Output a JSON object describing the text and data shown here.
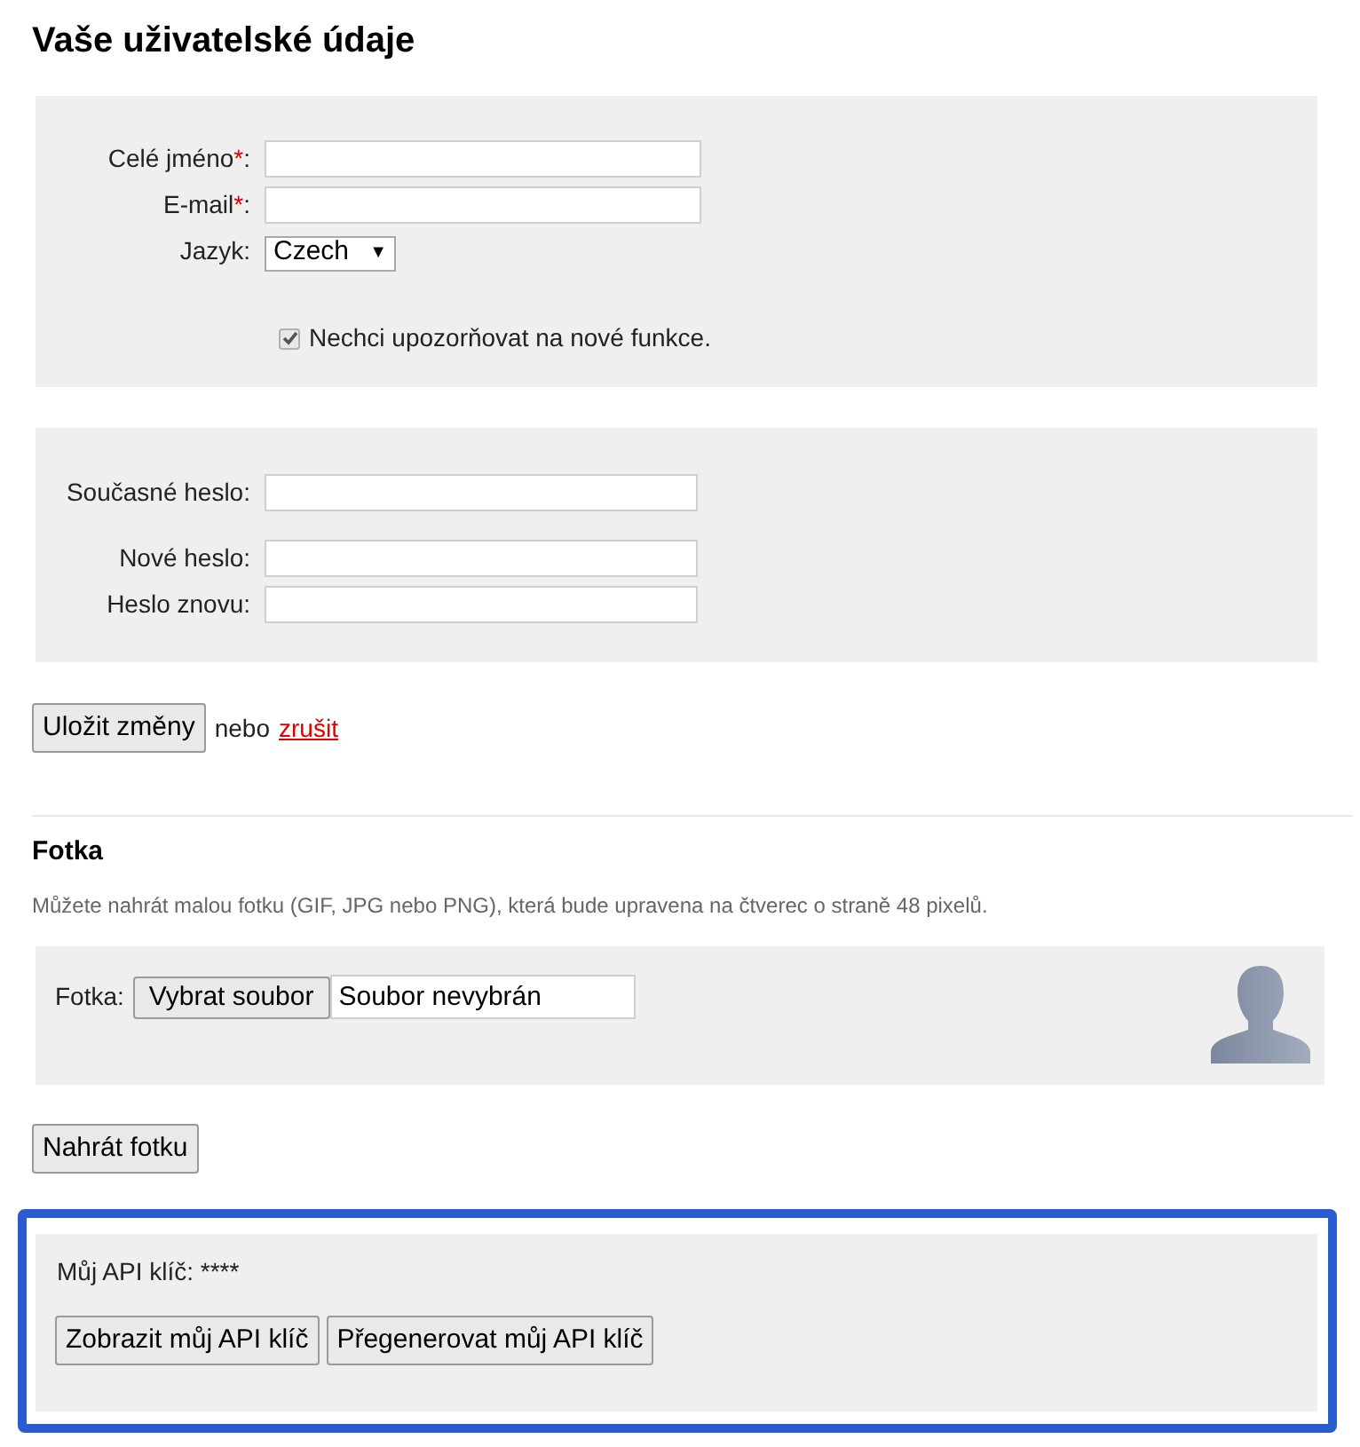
{
  "title": "Vaše uživatelské údaje",
  "profile_fields": [
    {
      "label": "Celé jméno",
      "marker": "*",
      "suffix": ":",
      "kind": "text"
    },
    {
      "label": "E-mail",
      "marker": "*",
      "suffix": ":",
      "kind": "text"
    },
    {
      "label": "Jazyk",
      "suffix": ":",
      "kind": "select",
      "value": "Czech",
      "arrow": "▼"
    }
  ],
  "notify_checkbox": {
    "label": "Nechci upozorňovat na nové funkce.",
    "checked": true
  },
  "password_fields": [
    {
      "label": "Současné heslo:"
    },
    {
      "label": "Nové heslo:"
    },
    {
      "label": "Heslo znovu:"
    }
  ],
  "save": {
    "button": "Uložit změny",
    "or": "nebo",
    "cancel": "zrušit"
  },
  "photo": {
    "heading": "Fotka",
    "description": "Můžete nahrát malou fotku (GIF, JPG nebo PNG), která bude upravena na čtverec o straně 48 pixelů.",
    "label": "Fotka:",
    "choose_button": "Vybrat soubor",
    "file_status": "Soubor nevybrán",
    "upload_button": "Nahrát fotku"
  },
  "api": {
    "label": "Můj API klíč: ****",
    "buttons": [
      "Zobrazit můj API klíč",
      "Přegenerovat můj API klíč"
    ],
    "highlighted": true
  }
}
